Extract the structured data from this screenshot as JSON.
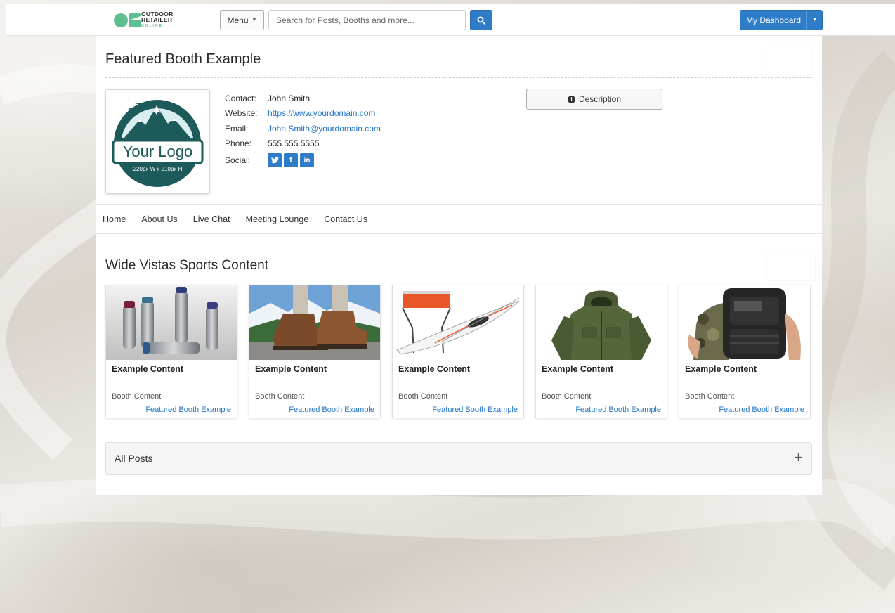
{
  "header": {
    "logo_line1": "OUTDOOR",
    "logo_line2": "RETAILER",
    "logo_line3": "ONLINE",
    "menu_label": "Menu",
    "search_placeholder": "Search for Posts, Booths and more...",
    "dashboard_label": "My Dashboard"
  },
  "booth": {
    "title": "Featured Booth Example",
    "logo_text": "Your Logo",
    "logo_size": "220px W x 210px H",
    "contact_label": "Contact:",
    "contact": "John Smith",
    "website_label": "Website:",
    "website": "https://www.yourdomain.com",
    "email_label": "Email:",
    "email": "John.Smith@yourdomain.com",
    "phone_label": "Phone:",
    "phone": "555.555.5555",
    "social_label": "Social:",
    "social": [
      "twitter",
      "facebook",
      "linkedin"
    ],
    "description_button": "Description"
  },
  "subnav": [
    "Home",
    "About Us",
    "Live Chat",
    "Meeting Lounge",
    "Contact Us"
  ],
  "content": {
    "section_title": "Wide Vistas Sports Content",
    "cards": [
      {
        "title": "Example Content",
        "type": "Booth Content",
        "booth": "Featured Booth Example",
        "image": "water-bottles"
      },
      {
        "title": "Example Content",
        "type": "Booth Content",
        "booth": "Featured Booth Example",
        "image": "hiking-boots"
      },
      {
        "title": "Example Content",
        "type": "Booth Content",
        "booth": "Featured Booth Example",
        "image": "folding-kayak"
      },
      {
        "title": "Example Content",
        "type": "Booth Content",
        "booth": "Featured Booth Example",
        "image": "green-jacket"
      },
      {
        "title": "Example Content",
        "type": "Booth Content",
        "booth": "Featured Booth Example",
        "image": "tactical-backpack"
      }
    ]
  },
  "posts": {
    "label": "All Posts",
    "toggle": "+"
  },
  "colors": {
    "accent": "#2f7dc8",
    "link": "#1f73c9",
    "logo_teal": "#1d5a5a"
  }
}
